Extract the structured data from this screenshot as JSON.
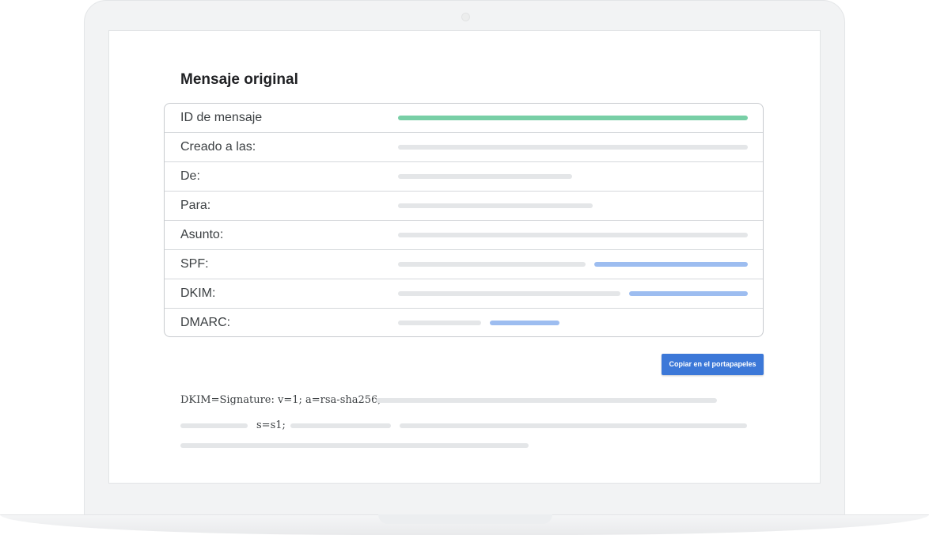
{
  "header": {
    "title": "Mensaje original"
  },
  "fields": [
    {
      "label": "ID de mensaje"
    },
    {
      "label": "Creado a las:"
    },
    {
      "label": "De:"
    },
    {
      "label": "Para:"
    },
    {
      "label": "Asunto:"
    },
    {
      "label": "SPF:"
    },
    {
      "label": "DKIM:"
    },
    {
      "label": "DMARC:"
    }
  ],
  "actions": {
    "copy_label": "Copiar en el portapapeles"
  },
  "raw": {
    "line1": "DKIM=Signature: v=1; a=rsa-sha256;",
    "line2": "s=s1;"
  },
  "colors": {
    "accent": "#3c78d8",
    "success_bar": "#78cfa6",
    "status_bar": "#9dbdf0",
    "placeholder_bar": "#e4e6e8"
  }
}
